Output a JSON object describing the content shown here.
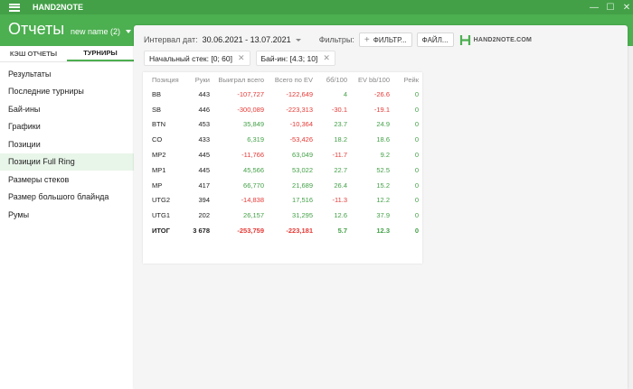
{
  "app": {
    "title": "HAND2NOTE"
  },
  "window_controls": {
    "minimize": "—",
    "maximize": "☐",
    "close": "✕"
  },
  "header": {
    "title": "Отчеты",
    "report_name": "new name (2)"
  },
  "sidebar": {
    "tabs": [
      {
        "label": "КЭШ ОТЧЕТЫ",
        "active": false
      },
      {
        "label": "ТУРНИРЫ",
        "active": true
      }
    ],
    "items": [
      {
        "label": "Результаты"
      },
      {
        "label": "Последние турниры"
      },
      {
        "label": "Бай-ины"
      },
      {
        "label": "Графики"
      },
      {
        "label": "Позиции"
      },
      {
        "label": "Позиции Full Ring",
        "active": true
      },
      {
        "label": "Размеры стеков"
      },
      {
        "label": "Размер большого блайнда"
      },
      {
        "label": "Румы"
      }
    ]
  },
  "toolbar": {
    "interval_label": "Интервал дат:",
    "date_range": "30.06.2021 - 13.07.2021",
    "filters_label": "Фильтры:",
    "filter_button": "ФИЛЬТР...",
    "file_button": "ФАЙЛ...",
    "logo_text": "HAND2NOTE.COM"
  },
  "chips": [
    {
      "label": "Начальный стек: [0; 60]"
    },
    {
      "label": "Бай-ин: [4.3; 10]"
    }
  ],
  "table": {
    "headers": [
      "Позиция",
      "Руки",
      "Выиграл всего",
      "Всего по EV",
      "бб/100",
      "EV bb/100",
      "Рейк"
    ],
    "rows": [
      {
        "position": "BB",
        "hands": "443",
        "won": "-107,727",
        "ev": "-122,649",
        "bb100": "4",
        "evbb": "-26.6",
        "rake": "0"
      },
      {
        "position": "SB",
        "hands": "446",
        "won": "-300,089",
        "ev": "-223,313",
        "bb100": "-30.1",
        "evbb": "-19.1",
        "rake": "0"
      },
      {
        "position": "BTN",
        "hands": "453",
        "won": "35,849",
        "ev": "-10,364",
        "bb100": "23.7",
        "evbb": "24.9",
        "rake": "0"
      },
      {
        "position": "CO",
        "hands": "433",
        "won": "6,319",
        "ev": "-53,426",
        "bb100": "18.2",
        "evbb": "18.6",
        "rake": "0"
      },
      {
        "position": "MP2",
        "hands": "445",
        "won": "-11,766",
        "ev": "63,049",
        "bb100": "-11.7",
        "evbb": "9.2",
        "rake": "0"
      },
      {
        "position": "MP1",
        "hands": "445",
        "won": "45,566",
        "ev": "53,022",
        "bb100": "22.7",
        "evbb": "52.5",
        "rake": "0"
      },
      {
        "position": "MP",
        "hands": "417",
        "won": "66,770",
        "ev": "21,689",
        "bb100": "26.4",
        "evbb": "15.2",
        "rake": "0"
      },
      {
        "position": "UTG2",
        "hands": "394",
        "won": "-14,838",
        "ev": "17,516",
        "bb100": "-11.3",
        "evbb": "12.2",
        "rake": "0"
      },
      {
        "position": "UTG1",
        "hands": "202",
        "won": "26,157",
        "ev": "31,295",
        "bb100": "12.6",
        "evbb": "37.9",
        "rake": "0"
      }
    ],
    "total": {
      "position": "ИТОГ",
      "hands": "3 678",
      "won": "-253,759",
      "ev": "-223,181",
      "bb100": "5.7",
      "evbb": "12.3",
      "rake": "0"
    }
  },
  "colors": {
    "brand": "#4caf50",
    "negative": "#e53935",
    "positive": "#43a047"
  }
}
